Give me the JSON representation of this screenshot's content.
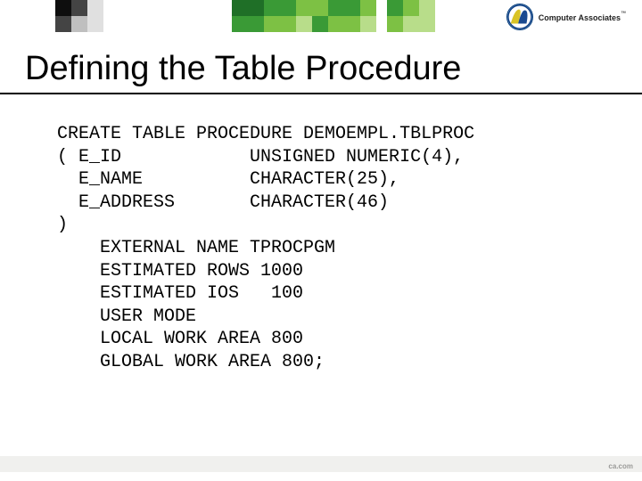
{
  "brand": {
    "name": "Computer Associates",
    "tm": "™",
    "badge_label": "CA company logo"
  },
  "heading": "Defining the Table Procedure",
  "code": "CREATE TABLE PROCEDURE DEMOEMPL.TBLPROC\n( E_ID            UNSIGNED NUMERIC(4),\n  E_NAME          CHARACTER(25),\n  E_ADDRESS       CHARACTER(46)\n)\n    EXTERNAL NAME TPROCPGM\n    ESTIMATED ROWS 1000\n    ESTIMATED IOS   100\n    USER MODE\n    LOCAL WORK AREA 800\n    GLOBAL WORK AREA 800;",
  "footer": "ca.com"
}
